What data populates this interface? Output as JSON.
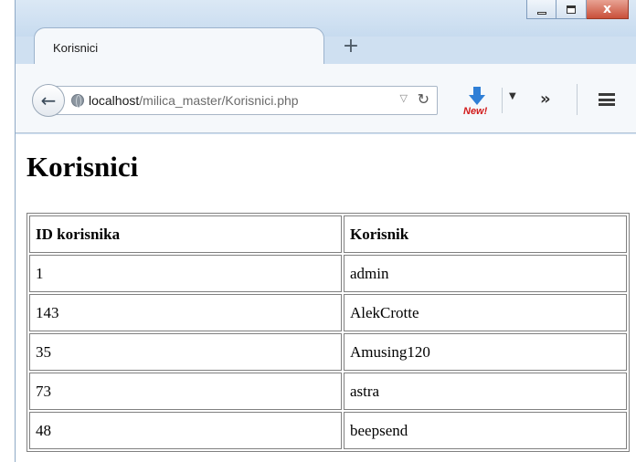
{
  "window": {
    "controls": {
      "minimize": "",
      "maximize": "",
      "close": "x"
    }
  },
  "tabs": [
    {
      "label": "Korisnici"
    }
  ],
  "new_tab_icon": "plus-icon",
  "navbar": {
    "back_icon": "back-arrow-icon",
    "url_host": "localhost",
    "url_path": "/milica_master/Korisnici.php",
    "download_badge": "New!",
    "overflow_glyph": "»"
  },
  "page": {
    "title": "Korisnici"
  },
  "table": {
    "columns": [
      "ID korisnika",
      "Korisnik"
    ],
    "rows": [
      [
        "1",
        "admin"
      ],
      [
        "143",
        "AlekCrotte"
      ],
      [
        "35",
        "Amusing120"
      ],
      [
        "73",
        "astra"
      ],
      [
        "48",
        "beepsend"
      ]
    ]
  }
}
